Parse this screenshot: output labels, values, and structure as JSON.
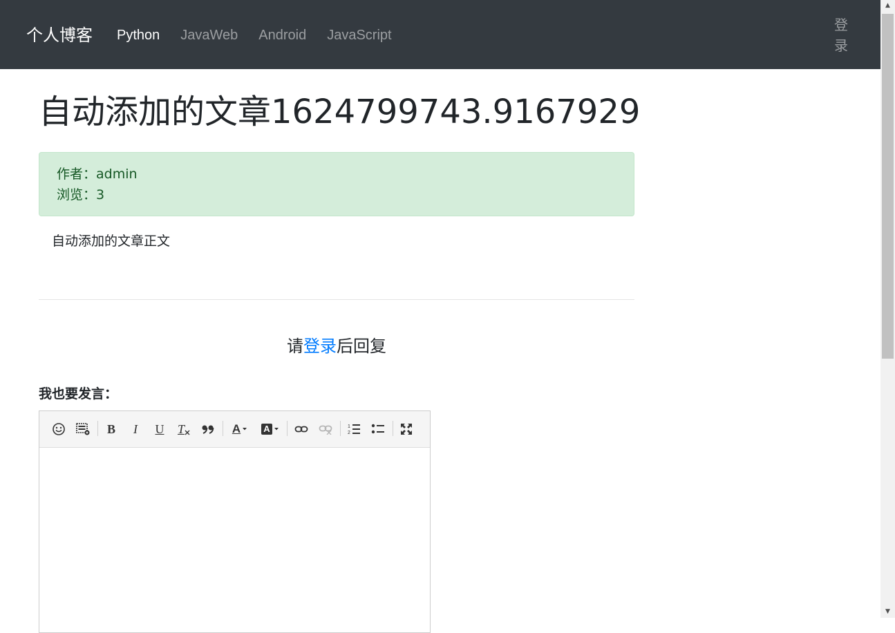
{
  "navbar": {
    "brand": "个人博客",
    "links": [
      "Python",
      "JavaWeb",
      "Android",
      "JavaScript"
    ],
    "login_line1": "登",
    "login_line2": "录"
  },
  "article": {
    "title": "自动添加的文章1624799743.9167929",
    "author_line": "作者：admin",
    "views_line": "浏览：3",
    "body": "自动添加的文章正文"
  },
  "reply": {
    "prefix": "请",
    "link": "登录",
    "suffix": "后回复"
  },
  "comment": {
    "label": "我也要发言："
  },
  "editor_toolbar": {
    "bold": "B",
    "italic": "I",
    "underline": "U",
    "clear_format": "T",
    "blockquote": "”",
    "font_color": "A",
    "background_color": "A"
  },
  "colors": {
    "navbar_bg": "#343a40",
    "alert_bg": "#d4edda",
    "alert_text": "#155724",
    "link": "#007bff"
  }
}
